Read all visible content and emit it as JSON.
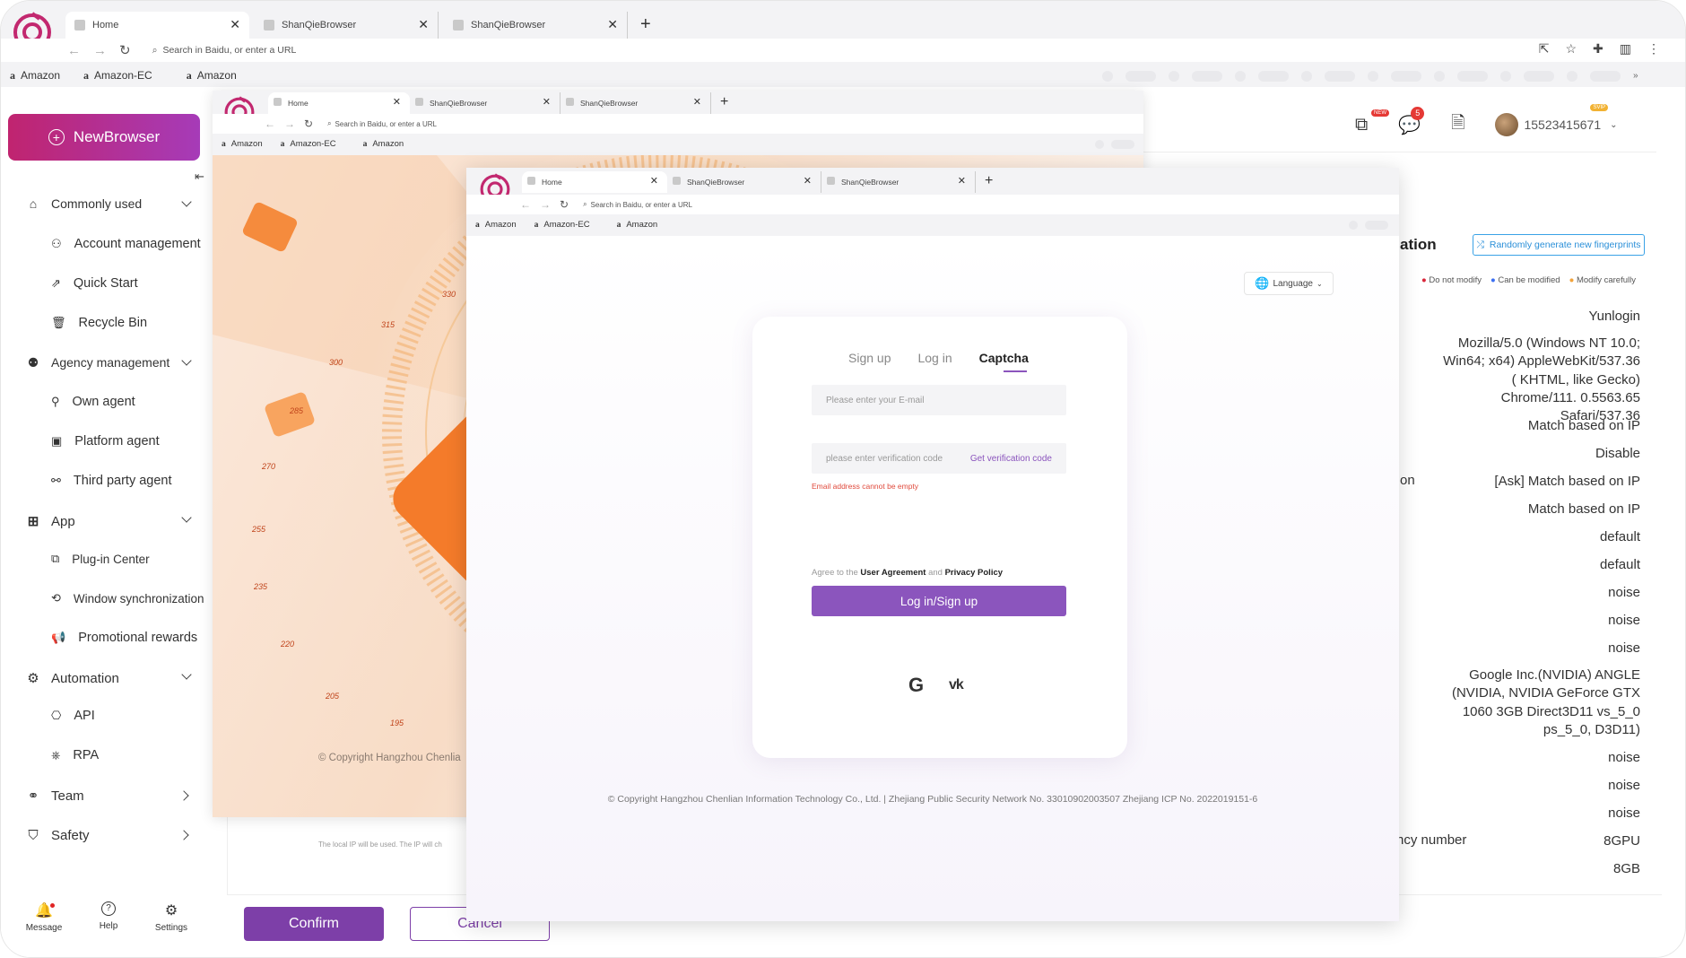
{
  "browser1": {
    "tabs": [
      {
        "label": "Home"
      },
      {
        "label": "ShanQieBrowser"
      },
      {
        "label": "ShanQieBrowser"
      }
    ],
    "address_placeholder": "Search in Baidu, or enter a URL",
    "bookmarks": [
      "Amazon",
      "Amazon-EC",
      "Amazon"
    ]
  },
  "browser2": {
    "tabs": [
      {
        "label": "Home"
      },
      {
        "label": "ShanQieBrowser"
      },
      {
        "label": "ShanQieBrowser"
      }
    ],
    "address_placeholder": "Search in Baidu, or enter a URL",
    "bookmarks": [
      "Amazon",
      "Amazon-EC",
      "Amazon"
    ]
  },
  "browser3": {
    "tabs": [
      {
        "label": "Home"
      },
      {
        "label": "ShanQieBrowser"
      },
      {
        "label": "ShanQieBrowser"
      }
    ],
    "address_placeholder": "Search in Baidu, or enter a URL",
    "bookmarks": [
      "Amazon",
      "Amazon-EC",
      "Amazon"
    ]
  },
  "sidebar": {
    "new_browser": "NewBrowser",
    "sections": [
      {
        "label": "Commonly used",
        "items": [
          "Account management",
          "Quick Start",
          "Recycle Bin"
        ]
      },
      {
        "label": "Agency management",
        "items": [
          "Own agent",
          "Platform agent",
          "Third party agent"
        ]
      },
      {
        "label": "App",
        "items": [
          "Plug-in Center",
          "Window synchronization",
          "Promotional rewards"
        ]
      },
      {
        "label": "Automation",
        "items": [
          "API",
          "RPA"
        ]
      },
      {
        "label": "Team",
        "items": []
      },
      {
        "label": "Safety",
        "items": []
      }
    ],
    "bottom": [
      "Message",
      "Help",
      "Settings"
    ]
  },
  "header": {
    "badge_new": "NEW",
    "message_count": "5",
    "username": "15523415671",
    "vip_badge": "SVIP"
  },
  "hero": {
    "speed_ticks": [
      "330",
      "315",
      "300",
      "285",
      "270",
      "255",
      "235",
      "220",
      "205",
      "195"
    ],
    "copyright": "© Copyright Hangzhou Chenlia",
    "behind_text": "The local IP will be used. The IP will ch"
  },
  "fingerprint": {
    "title": "ation",
    "random_button": "Randomly generate new fingerprints",
    "legend": [
      "Do not modify",
      "Can be modified",
      "Modify carefully"
    ],
    "legend_colors": [
      "#d9263a",
      "#3b6ff2",
      "#f2a33b"
    ],
    "values": [
      "Yunlogin",
      "Mozilla/5.0 (Windows NT 10.0; Win64; x64) AppleWebKit/537.36 ( KHTML, like Gecko) Chrome/111. 0.5563.65 Safari/537.36",
      "Match based on IP",
      "Disable",
      "[Ask] Match based on IP",
      "Match based on IP",
      "default",
      "default",
      "noise",
      "noise",
      "noise",
      "Google Inc.(NVIDIA) ANGLE (NVIDIA, NVIDIA GeForce GTX 1060 3GB Direct3D11 vs_5_0 ps_5_0, D3D11)",
      "noise",
      "noise",
      "noise",
      "8GPU",
      "8GB"
    ],
    "left_label_on": "on",
    "left_label_concurrency": "ncy number"
  },
  "footer_buttons": {
    "confirm": "Confirm",
    "cancel": "Cancel"
  },
  "login": {
    "language": "Language",
    "tabs": [
      "Sign up",
      "Log in",
      "Captcha"
    ],
    "active_tab": "Captcha",
    "email_placeholder": "Please enter your E-mail",
    "code_placeholder": "please enter verification code",
    "get_code": "Get verification code",
    "error": "Email address cannot be empty",
    "agree_prefix": "Agree to the",
    "user_agreement": "User Agreement",
    "and": "and",
    "privacy_policy": "Privacy Policy",
    "submit": "Log in/Sign up",
    "brand_color": "#8b55bd",
    "copyright": "© Copyright Hangzhou Chenlian Information Technology Co., Ltd.  |  Zhejiang Public Security Network No. 33010902003507 Zhejiang ICP No. 2022019151-6"
  }
}
